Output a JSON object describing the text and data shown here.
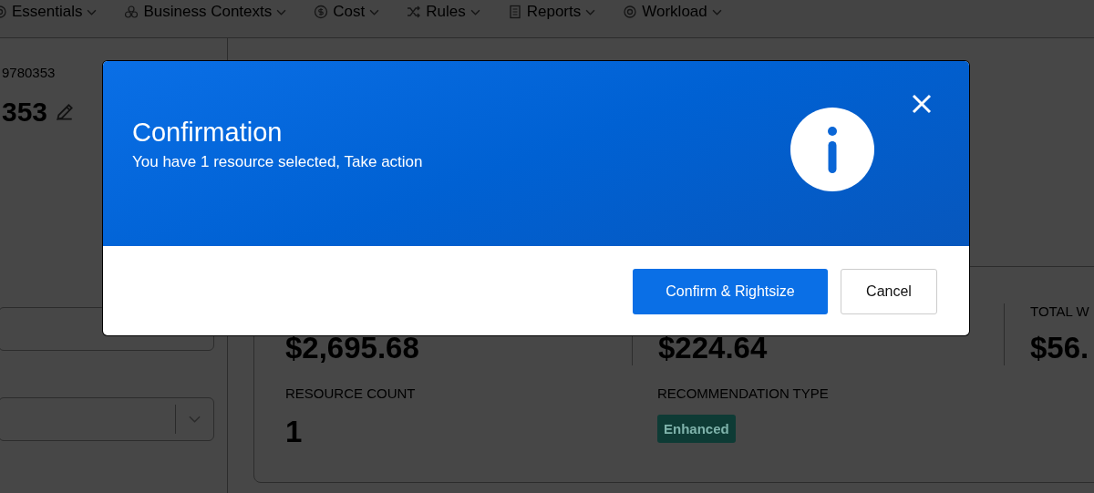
{
  "nav": [
    {
      "label": "Essentials"
    },
    {
      "label": "Business Contexts"
    },
    {
      "label": "Cost"
    },
    {
      "label": "Rules"
    },
    {
      "label": "Reports"
    },
    {
      "label": "Workload"
    }
  ],
  "sidebar": {
    "id_text": "9780353",
    "name": "353"
  },
  "summary": {
    "metrics": [
      {
        "value": "$2,695.68"
      },
      {
        "value": "$224.64"
      },
      {
        "label": "TOTAL W",
        "value": "$56."
      }
    ],
    "resource_count": {
      "label": "RESOURCE COUNT",
      "value": "1"
    },
    "recommendation_type": {
      "label": "RECOMMENDATION TYPE",
      "badge": "Enhanced"
    }
  },
  "modal": {
    "title": "Confirmation",
    "message": "You have 1 resource selected, Take action",
    "buttons": [
      {
        "label": "Confirm & Rightsize",
        "kind": "primary"
      },
      {
        "label": "Cancel",
        "kind": "secondary"
      }
    ]
  }
}
